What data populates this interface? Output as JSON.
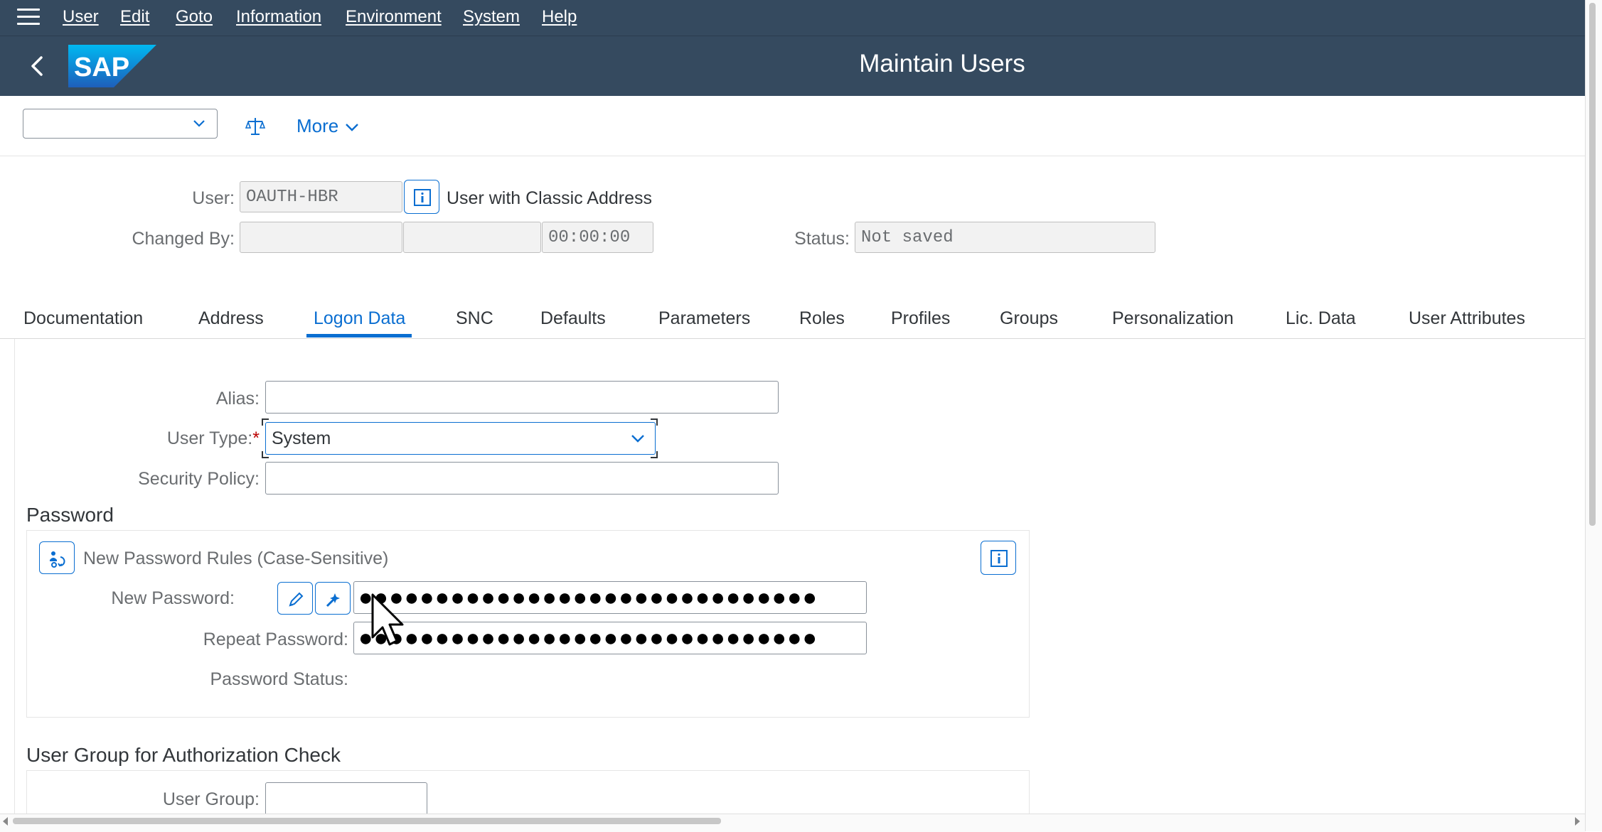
{
  "menu": {
    "items": [
      "User",
      "Edit",
      "Goto",
      "Information",
      "Environment",
      "System",
      "Help"
    ]
  },
  "shell": {
    "title": "Maintain Users",
    "logo_text": "SAP"
  },
  "toolbar": {
    "select_value": "",
    "more_label": "More"
  },
  "header": {
    "user_label": "User:",
    "user_value": "OAUTH-HBR",
    "user_desc": "User with Classic Address",
    "changed_by_label": "Changed By:",
    "changed_by_value": "",
    "changed_date_value": "",
    "changed_time_value": "00:00:00",
    "status_label": "Status:",
    "status_value": "Not saved"
  },
  "tabs": [
    "Documentation",
    "Address",
    "Logon Data",
    "SNC",
    "Defaults",
    "Parameters",
    "Roles",
    "Profiles",
    "Groups",
    "Personalization",
    "Lic. Data",
    "User Attributes"
  ],
  "active_tab": "Logon Data",
  "logon": {
    "alias_label": "Alias:",
    "alias_value": "",
    "user_type_label": "User Type:",
    "user_type_required": "*",
    "user_type_value": "System",
    "security_policy_label": "Security Policy:",
    "security_policy_value": ""
  },
  "password": {
    "section_title": "Password",
    "rules_label": "New Password Rules (Case-Sensitive)",
    "new_label": "New Password:",
    "new_value": "●●●●●●●●●●●●●●●●●●●●●●●●●●●●●●",
    "repeat_label": "Repeat Password:",
    "repeat_value": "●●●●●●●●●●●●●●●●●●●●●●●●●●●●●●",
    "status_label": "Password Status:"
  },
  "user_group": {
    "section_title": "User Group for Authorization Check",
    "label": "User Group:",
    "value": ""
  },
  "colors": {
    "shell": "#354a5f",
    "accent": "#0a6ed1",
    "required": "#bb0000"
  }
}
